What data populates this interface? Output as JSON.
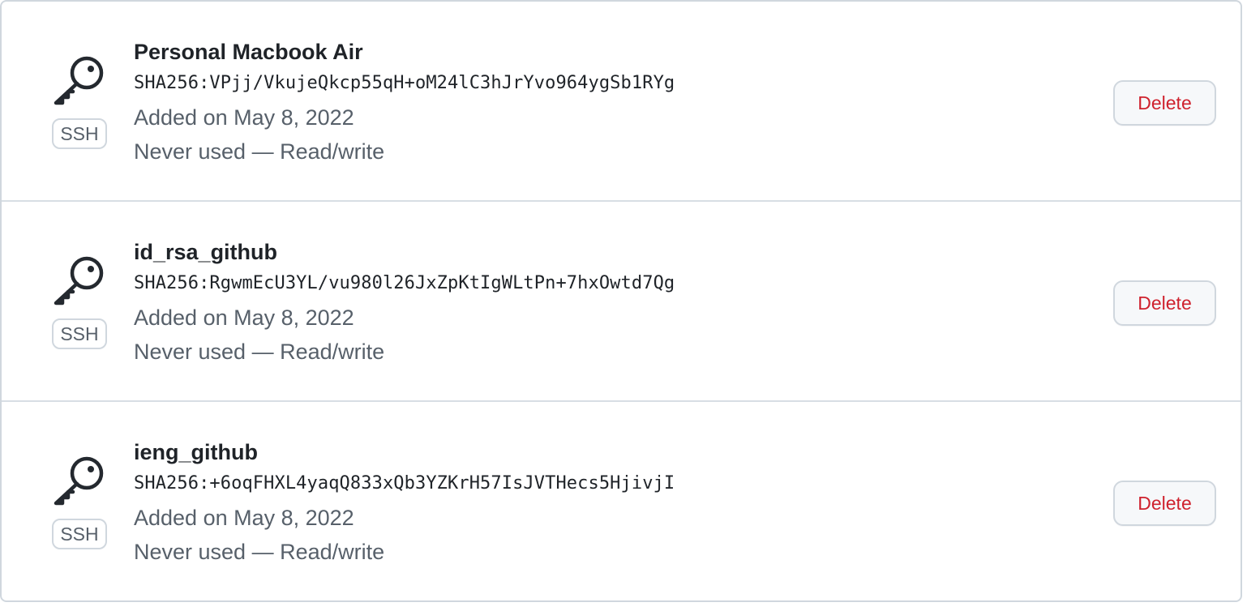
{
  "ssh_keys": [
    {
      "title": "Personal Macbook Air",
      "fingerprint": "SHA256:VPjj/VkujeQkcp55qH+oM24lC3hJrYvo964ygSb1RYg",
      "added": "Added on May 8, 2022",
      "usage": "Never used — Read/write",
      "type_label": "SSH",
      "delete_label": "Delete",
      "icon": "key-icon"
    },
    {
      "title": "id_rsa_github",
      "fingerprint": "SHA256:RgwmEcU3YL/vu980l26JxZpKtIgWLtPn+7hxOwtd7Qg",
      "added": "Added on May 8, 2022",
      "usage": "Never used — Read/write",
      "type_label": "SSH",
      "delete_label": "Delete",
      "icon": "key-icon"
    },
    {
      "title": "ieng_github",
      "fingerprint": "SHA256:+6oqFHXL4yaqQ833xQb3YZKrH57IsJVTHecs5HjivjI",
      "added": "Added on May 8, 2022",
      "usage": "Never used — Read/write",
      "type_label": "SSH",
      "delete_label": "Delete",
      "icon": "key-icon"
    }
  ],
  "colors": {
    "danger": "#cf222e",
    "muted_text": "#57606a",
    "border": "#d0d7de",
    "button_bg": "#f6f8fa"
  }
}
